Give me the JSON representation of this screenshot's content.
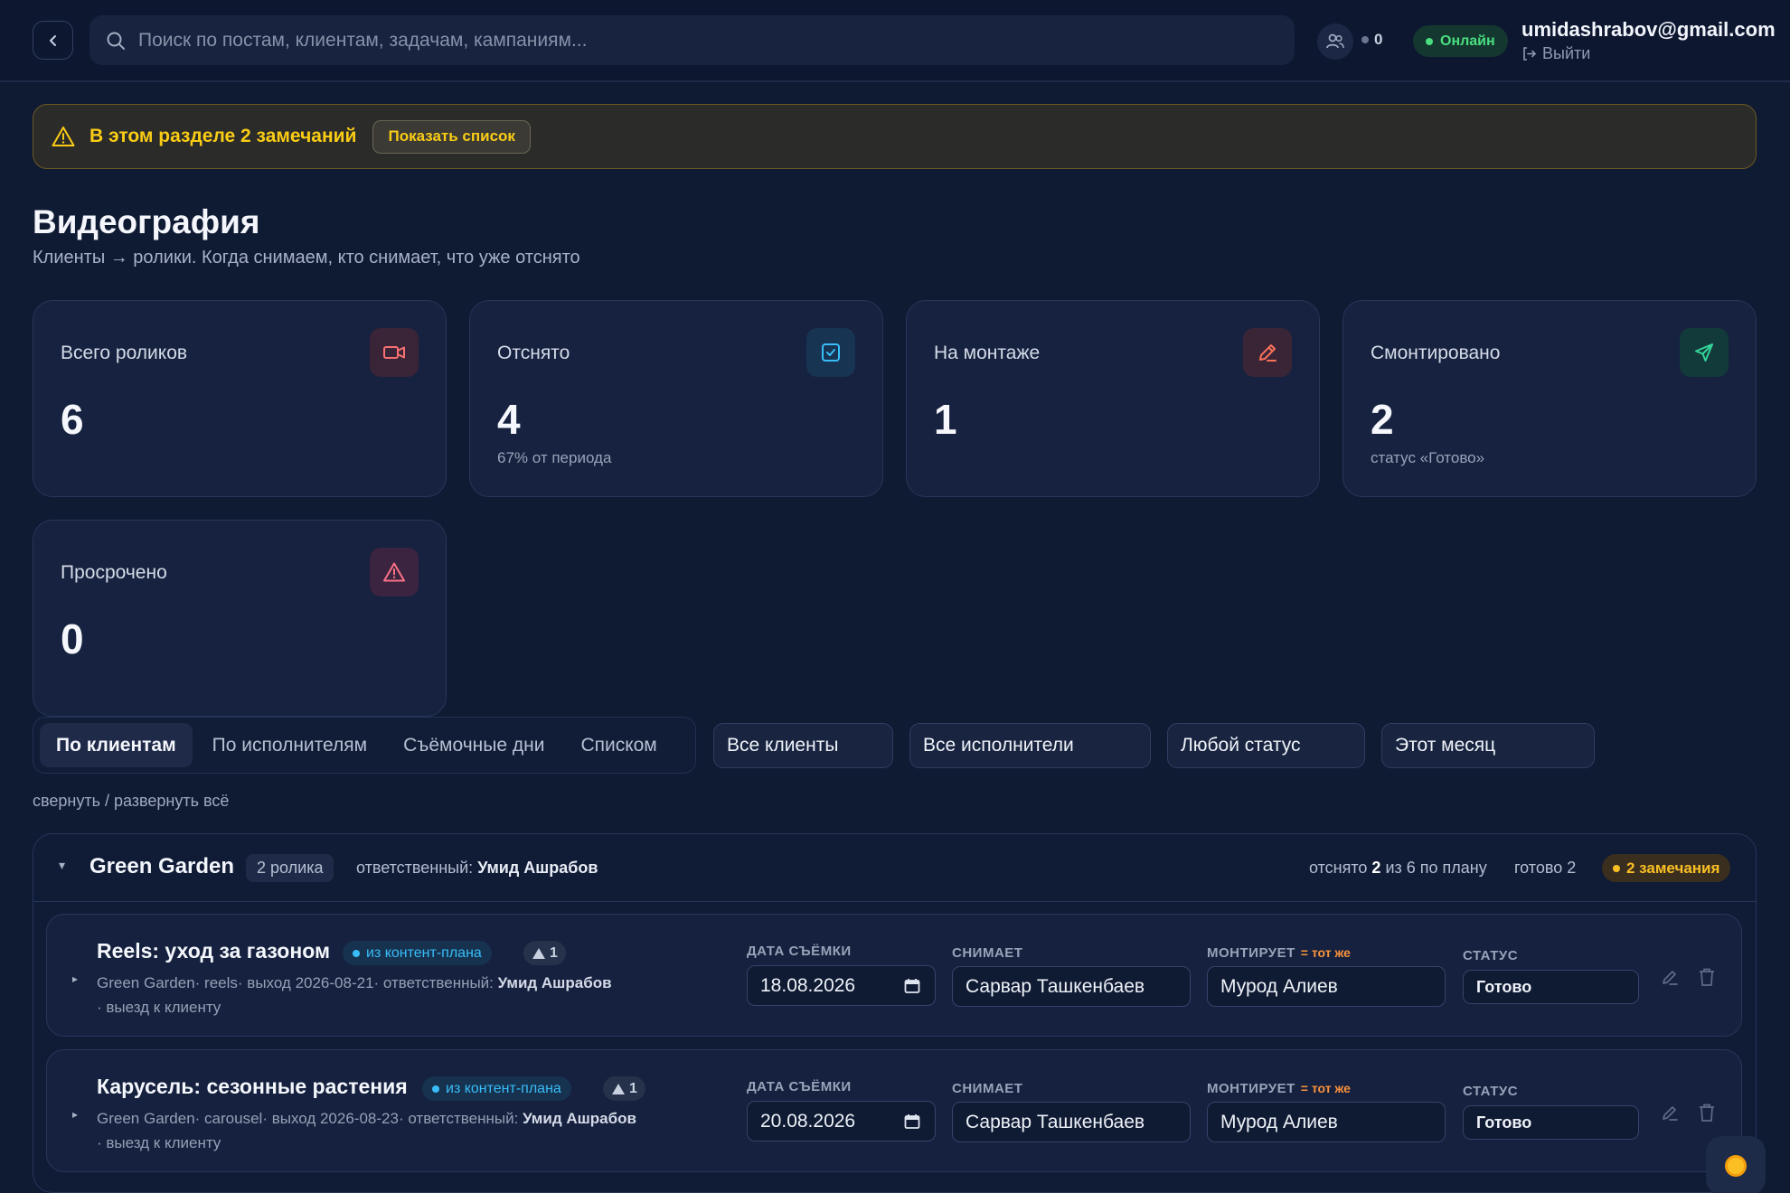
{
  "header": {
    "search_placeholder": "Поиск по постам, клиентам, задачам, кампаниям...",
    "users_count": "0",
    "online_label": "Онлайн",
    "user_email": "umidashrabov@gmail.com",
    "logout_label": "Выйти"
  },
  "banner": {
    "text": "В этом разделе 2 замечаний",
    "button_label": "Показать список"
  },
  "page": {
    "title": "Видеография",
    "subtitle": "Клиенты → ролики. Когда снимаем, кто снимает, что уже отснято"
  },
  "stats": [
    {
      "label": "Всего роликов",
      "value": "6",
      "sub": "",
      "icon": "video-camera-icon",
      "color": "#f87171"
    },
    {
      "label": "Отснято",
      "value": "4",
      "sub": "67% от периода",
      "icon": "check-square-icon",
      "color": "#38bdf8"
    },
    {
      "label": "На монтаже",
      "value": "1",
      "sub": "",
      "icon": "pencil-icon",
      "color": "#fb7159"
    },
    {
      "label": "Смонтировано",
      "value": "2",
      "sub": "статус «Готово»",
      "icon": "send-icon",
      "color": "#34d399"
    },
    {
      "label": "Просрочено",
      "value": "0",
      "sub": "",
      "icon": "alert-triangle-icon",
      "color": "#fb7185"
    }
  ],
  "tabs": [
    {
      "label": "По клиентам",
      "active": true
    },
    {
      "label": "По исполнителям",
      "active": false
    },
    {
      "label": "Съёмочные дни",
      "active": false
    },
    {
      "label": "Списком",
      "active": false
    }
  ],
  "filters": {
    "clients": "Все клиенты",
    "performers": "Все исполнители",
    "status": "Любой статус",
    "period": "Этот месяц"
  },
  "collapse_label": "свернуть / развернуть всё",
  "group": {
    "toggle": "▾",
    "name": "Green Garden",
    "count_label": "2 ролика",
    "responsible_prefix": "ответственный:",
    "responsible_name": "Умид Ашрабов",
    "shot_prefix": "отснято",
    "shot_count": "2",
    "shot_suffix": "из 6 по плану",
    "ready_label": "готово 2",
    "notes_label": "2 замечания"
  },
  "field_labels": {
    "date": "ДАТА СЪЁМКИ",
    "shooter": "СНИМАЕТ",
    "editor": "МОНТИРУЕТ",
    "same": "= тот же",
    "status": "СТАТУС"
  },
  "videos": [
    {
      "title": "Reels: уход за газоном",
      "tag": "из контент-плана",
      "alert_count": "1",
      "meta_line1": "Green Garden· reels· выход 2026-08-21· ответственный:",
      "meta_responsible": "Умид Ашрабов",
      "meta_line2": "· выезд к клиенту",
      "date": "18.08.2026",
      "shooter": "Сарвар Ташкенбаев",
      "editor": "Мурод Алиев",
      "status": "Готово"
    },
    {
      "title": "Карусель: сезонные растения",
      "tag": "из контент-плана",
      "alert_count": "1",
      "meta_line1": "Green Garden· carousel· выход 2026-08-23· ответственный:",
      "meta_responsible": "Умид Ашрабов",
      "meta_line2": "· выезд к клиенту",
      "date": "20.08.2026",
      "shooter": "Сарвар Ташкенбаев",
      "editor": "Мурод Алиев",
      "status": "Готово"
    }
  ],
  "colors": {
    "background": "#0f1a33",
    "warning": "#facc15",
    "online": "#4ade80",
    "tag": "#38bdf8",
    "same_marker": "#fb923c"
  }
}
